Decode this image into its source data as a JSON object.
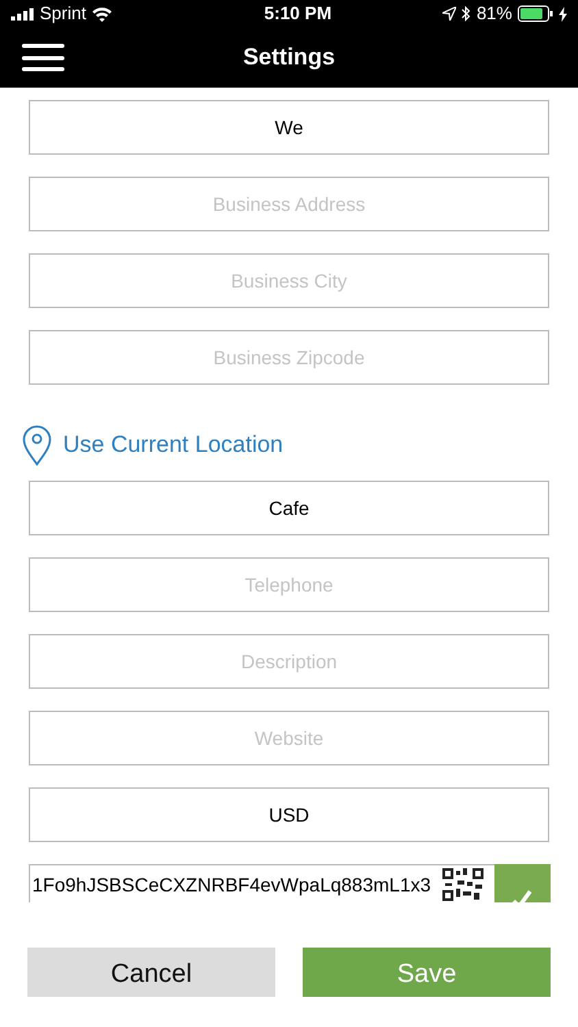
{
  "status_bar": {
    "carrier": "Sprint",
    "time": "5:10 PM",
    "battery": "81%"
  },
  "header": {
    "title": "Settings"
  },
  "fields_top": [
    {
      "value": "We"
    },
    {
      "placeholder": "Business Address"
    },
    {
      "placeholder": "Business City"
    },
    {
      "placeholder": "Business Zipcode"
    }
  ],
  "location_link": "Use Current Location",
  "fields_bottom": [
    {
      "value": "Cafe"
    },
    {
      "placeholder": "Telephone"
    },
    {
      "placeholder": "Description"
    },
    {
      "placeholder": "Website"
    },
    {
      "value": "USD"
    }
  ],
  "wallet": {
    "value": "1Fo9hJSBSCeCXZNRBF4evWpaLq883mL1x3",
    "checked": true
  },
  "buttons": [
    {
      "label": "Cancel",
      "kind": "secondary"
    },
    {
      "label": "Save",
      "kind": "primary"
    }
  ]
}
